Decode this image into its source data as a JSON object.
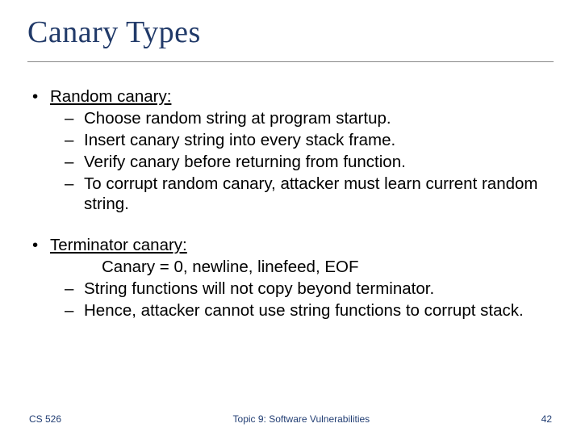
{
  "title": "Canary Types",
  "bullets": {
    "random": {
      "head": "Random canary:",
      "items": [
        "Choose random string at program startup.",
        "Insert canary string into every stack frame.",
        "Verify canary before returning from function.",
        "To corrupt random canary, attacker must learn current random string."
      ]
    },
    "terminator": {
      "head": "Terminator canary:",
      "inset": "Canary =  0, newline, linefeed, EOF",
      "items": [
        "String functions will not copy beyond terminator.",
        "Hence, attacker cannot use string functions to corrupt stack."
      ]
    }
  },
  "footer": {
    "course": "CS 526",
    "topic": "Topic 9: Software Vulnerabilities",
    "page": "42"
  }
}
